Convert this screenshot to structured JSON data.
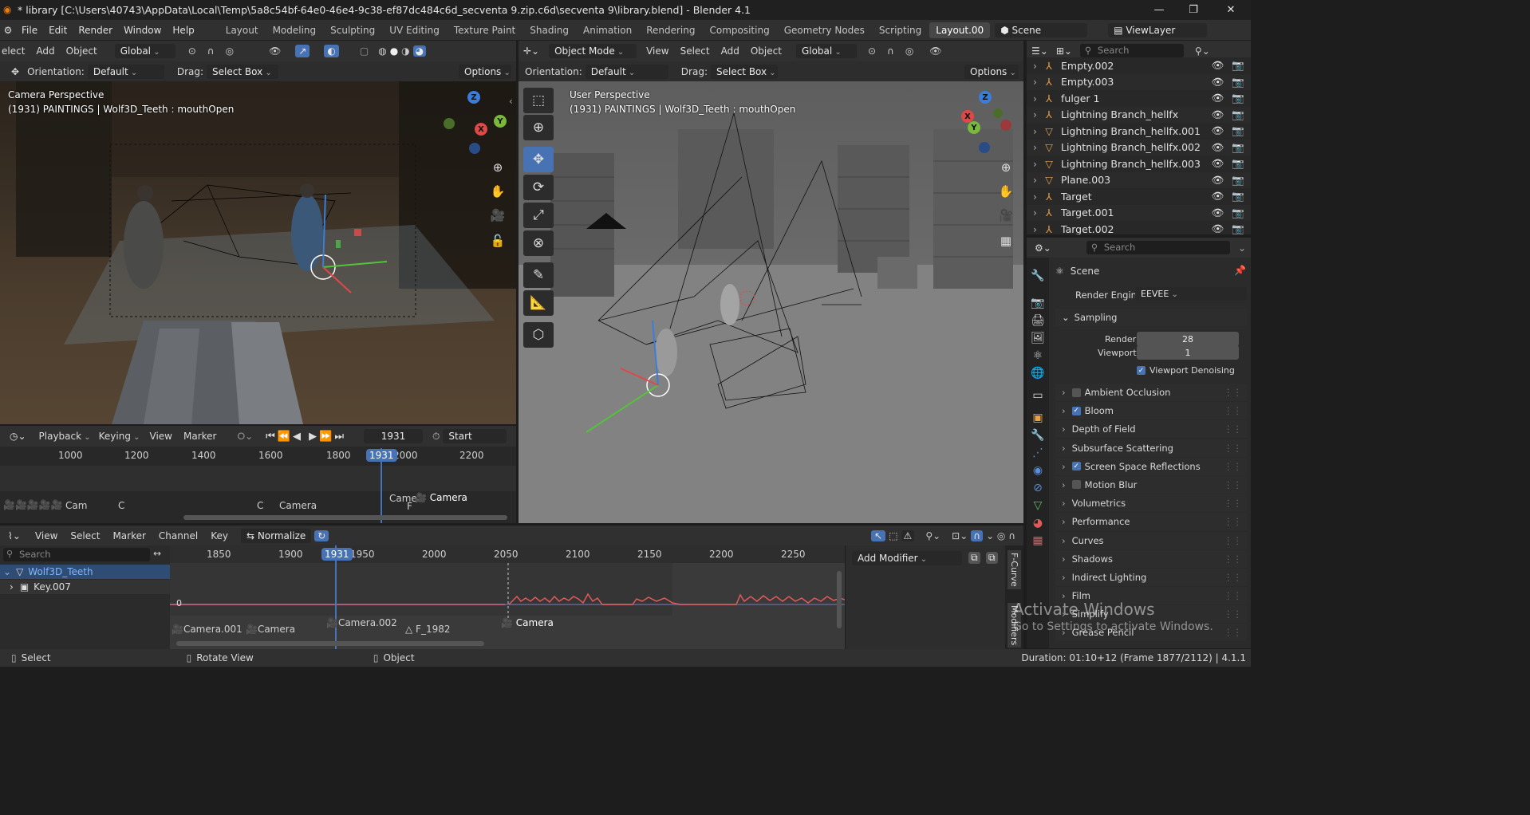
{
  "window": {
    "title": "* library [C:\\Users\\40743\\AppData\\Local\\Temp\\5a8c54bf-64e0-46e4-9c38-ef87dc484c6d_secventa 9.zip.c6d\\secventa 9\\library.blend] - Blender 4.1",
    "minimize": "—",
    "maximize": "❐",
    "close": "✕"
  },
  "menu": [
    "File",
    "Edit",
    "Render",
    "Window",
    "Help"
  ],
  "workspaces": [
    "Layout",
    "Modeling",
    "Sculpting",
    "UV Editing",
    "Texture Paint",
    "Shading",
    "Animation",
    "Rendering",
    "Compositing",
    "Geometry Nodes",
    "Scripting",
    "Layout.00"
  ],
  "scene": {
    "label": "Scene",
    "viewlayer": "ViewLayer"
  },
  "left_viewport": {
    "menu": [
      "elect",
      "Add",
      "Object"
    ],
    "transform": "Global",
    "orientation_label": "Orientation:",
    "orientation": "Default",
    "drag_label": "Drag:",
    "drag": "Select Box",
    "options": "Options",
    "perspective": "Camera Perspective",
    "info": "(1931) PAINTINGS | Wolf3D_Teeth : mouthOpen"
  },
  "right_viewport": {
    "mode": "Object Mode",
    "menu": [
      "View",
      "Select",
      "Add",
      "Object"
    ],
    "transform": "Global",
    "orientation_label": "Orientation:",
    "orientation": "Default",
    "drag_label": "Drag:",
    "drag": "Select Box",
    "options": "Options",
    "perspective": "User Perspective",
    "info": "(1931) PAINTINGS | Wolf3D_Teeth : mouthOpen"
  },
  "timeline": {
    "menu": [
      "Playback",
      "Keying",
      "View",
      "Marker"
    ],
    "current_frame": "1931",
    "start_label": "Start",
    "ticks": [
      "1000",
      "1200",
      "1400",
      "1600",
      "1800",
      "2000",
      "2200"
    ],
    "markers": [
      "Cam",
      "C",
      "C",
      "Camera",
      "Came",
      "F",
      "Camera"
    ]
  },
  "graph_editor": {
    "menu": [
      "View",
      "Select",
      "Marker",
      "Channel",
      "Key"
    ],
    "normalize": "Normalize",
    "search_placeholder": "Search",
    "current_frame": "1931",
    "ticks": [
      "1850",
      "1900",
      "1950",
      "2000",
      "2050",
      "2100",
      "2150",
      "2200",
      "2250"
    ],
    "zero_label": "0",
    "channels": [
      {
        "name": "Wolf3D_Teeth"
      },
      {
        "name": "Key.007"
      }
    ],
    "markers": [
      "Camera.001",
      "Camera",
      "Camera.002",
      "F_1982",
      "Camera"
    ],
    "add_modifier": "Add Modifier",
    "side_tabs": [
      "F-Curve",
      "Modifiers"
    ]
  },
  "outliner": {
    "search_placeholder": "Search",
    "items": [
      "Empty.002",
      "Empty.003",
      "fulger 1",
      "Lightning Branch_hellfx",
      "Lightning Branch_hellfx.001",
      "Lightning Branch_hellfx.002",
      "Lightning Branch_hellfx.003",
      "Plane.003",
      "Target",
      "Target.001",
      "Target.002"
    ]
  },
  "properties": {
    "search_placeholder": "Search",
    "context": "Scene",
    "render_engine_label": "Render Engine",
    "render_engine": "EEVEE",
    "sampling": "Sampling",
    "render_label": "Render",
    "render_value": "28",
    "viewport_label": "Viewport",
    "viewport_value": "1",
    "viewport_denoising": "Viewport Denoising",
    "sections": [
      {
        "label": "Ambient Occlusion",
        "checked": false
      },
      {
        "label": "Bloom",
        "checked": true
      },
      {
        "label": "Depth of Field"
      },
      {
        "label": "Subsurface Scattering"
      },
      {
        "label": "Screen Space Reflections",
        "checked": true
      },
      {
        "label": "Motion Blur",
        "checked": false
      },
      {
        "label": "Volumetrics"
      },
      {
        "label": "Performance"
      },
      {
        "label": "Curves"
      },
      {
        "label": "Shadows"
      },
      {
        "label": "Indirect Lighting"
      },
      {
        "label": "Film"
      },
      {
        "label": "Simplify"
      },
      {
        "label": "Grease Pencil"
      }
    ]
  },
  "watermark": {
    "line1": "Activate Windows",
    "line2": "Go to Settings to activate Windows."
  },
  "statusbar": {
    "select": "Select",
    "rotate": "Rotate View",
    "object": "Object",
    "duration": "Duration: 01:10+12 (Frame 1877/2112) | 4.1.1"
  },
  "colors": {
    "accent": "#4772b3",
    "header": "#303030",
    "panel": "#2d2d2d",
    "curve": "#e05a5a"
  }
}
